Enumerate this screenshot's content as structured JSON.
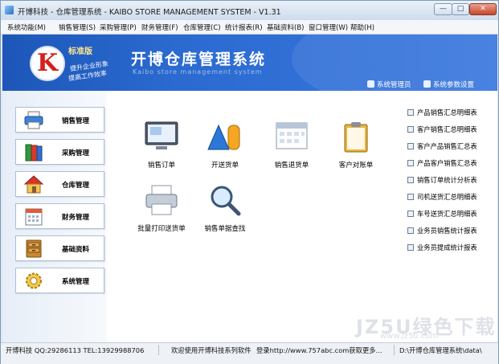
{
  "window": {
    "title": "开博科技 - 仓库管理系统 - KAIBO STORE MANAGEMENT SYSTEM - V1.31",
    "minimize_glyph": "—",
    "maximize_glyph": "□",
    "close_glyph": "✕"
  },
  "menu": [
    "系统功能(M)",
    "销售管理(S)",
    "采购管理(P)",
    "财务管理(F)",
    "仓库管理(C)",
    "统计报表(R)",
    "基础资料(B)",
    "窗口管理(W)",
    "帮助(H)"
  ],
  "banner": {
    "logo_letter": "K",
    "edition": "标准版",
    "slogan_1": "提升企业形象",
    "slogan_2": "提高工作效率",
    "title": "开博仓库管理系统",
    "subtitle": "Kaibo store management system",
    "links": {
      "admin": "系统管理员",
      "settings": "系统参数设置"
    }
  },
  "nav": [
    {
      "label": "销售管理",
      "icon": "printer-icon"
    },
    {
      "label": "采购管理",
      "icon": "books-icon"
    },
    {
      "label": "仓库管理",
      "icon": "house-icon"
    },
    {
      "label": "财务管理",
      "icon": "calendar-icon"
    },
    {
      "label": "基础资料",
      "icon": "cabinet-icon"
    },
    {
      "label": "系统管理",
      "icon": "gear-icon"
    }
  ],
  "tiles": [
    {
      "label": "销售订单",
      "icon": "monitor-icon"
    },
    {
      "label": "开送货单",
      "icon": "shapes-icon"
    },
    {
      "label": "销售退货单",
      "icon": "calendar-grid-icon"
    },
    {
      "label": "客户对账单",
      "icon": "clipboard-icon"
    },
    {
      "label": "批量打印送货单",
      "icon": "printer-icon"
    },
    {
      "label": "销售单据查找",
      "icon": "magnifier-icon"
    }
  ],
  "reports": [
    "产品销售汇总明细表",
    "客户销售汇总明细表",
    "客户产品销售汇总表",
    "产品客户销售汇总表",
    "销售订单统计分析表",
    "司机送货汇总明细表",
    "车号送货汇总明细表",
    "业务员销售统计报表",
    "业务员提成统计报表"
  ],
  "watermark": {
    "main": "JZ5U绿色下载",
    "sub": "www.jz5u.com"
  },
  "status": {
    "company": "开博科技  QQ:29286113  TEL:13929988706",
    "welcome": "欢迎使用开博科技系列软件",
    "login": "登录http://www.757abc.com获取更多...",
    "path": "D:\\开博仓库管理系统\\data\\"
  },
  "colors": {
    "banner_blue": "#2b6ad0",
    "logo_red": "#d52020",
    "edition_yellow": "#ffe890"
  }
}
